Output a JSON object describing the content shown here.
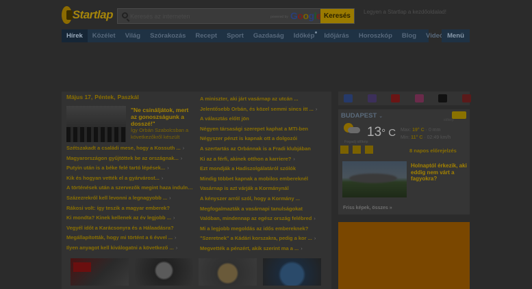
{
  "header": {
    "logo_text": "Startlap",
    "search_placeholder": "Keresés az interneten",
    "powered_by": "powered by",
    "google_letters": [
      {
        "ch": "G",
        "color": "#2a3f7a"
      },
      {
        "ch": "o",
        "color": "#7a1f1a"
      },
      {
        "ch": "o",
        "color": "#7a6200"
      },
      {
        "ch": "g",
        "color": "#2a3f7a"
      },
      {
        "ch": "l",
        "color": "#1f5a2a"
      },
      {
        "ch": "e",
        "color": "#7a1f1a"
      }
    ],
    "search_button": "Keresés",
    "top_links": [
      "Legyen a Startlap a kezdőoldalad!"
    ]
  },
  "nav": {
    "items": [
      {
        "label": "Hírek",
        "active": true
      },
      {
        "label": "Közélet"
      },
      {
        "label": "Világ"
      },
      {
        "label": "Szórakozás"
      },
      {
        "label": "Recept"
      },
      {
        "label": "Sport"
      },
      {
        "label": "Gazdaság"
      },
      {
        "label": "Időkép",
        "dot": true
      },
      {
        "label": "Időjárás"
      },
      {
        "label": "Horoszkóp"
      },
      {
        "label": "Blog"
      },
      {
        "label": "Videó"
      }
    ],
    "menu": "Menü"
  },
  "main": {
    "headline_bar": [
      "Május 17",
      "Péntek",
      "Paszkál"
    ],
    "featured": {
      "title": "\"Ne csináljátok, mert az gonoszságunk a dosszé!\"",
      "subtitle": "Így Orbán Szabolcsban a következőkről készült"
    },
    "left_list": [
      {
        "text": "Szétszakadt a családi mese, hogy a Kossuth ...",
        "more": true
      },
      {
        "text": "Magyarországon gyűjtöttek be az országnak...",
        "more": true
      },
      {
        "text": "Putyin után is a béke felé tartó lépések...",
        "more": true
      },
      {
        "text": "Kik és hogyan vették el a gyárvárost...",
        "more": true
      },
      {
        "text": "A történések után a szervezők megint haza indulnak...",
        "more": true
      },
      {
        "text": "Százezrekről kell levonni a legnagyobb ...",
        "more": true
      },
      {
        "text": "Rákosi volt: így teszik a magyar emberek?",
        "more": false
      },
      {
        "text": "Ki mondta? Kinek kellenek az év legjobb ...",
        "more": true
      },
      {
        "text": "Vegyél időt a Karácsonyra és a Hálaadásra?",
        "more": false
      },
      {
        "text": "Megállapították, hogy mi történt a 6 évvel ...",
        "more": true
      },
      {
        "text": "Ilyen anyagot kell kiválogatni a következő ...",
        "more": true
      }
    ],
    "right_list": [
      {
        "text": "A miniszter, aki járt vasárnap az utcán ...",
        "more": false
      },
      {
        "text": "Jelentősebb Orbán, és közel semmi sincs itt ...",
        "more": true
      },
      {
        "text": "A választás előtt jön",
        "more": false
      },
      {
        "text": "Négyen társasági szerepet kaphat a MTI-ben",
        "more": false
      },
      {
        "text": "Négyszer pénzt is kapnak ott a dolgozói",
        "more": false
      },
      {
        "text": "A szertartás az Orbánnak is a Fradi klubjában",
        "more": false
      },
      {
        "text": "Ki az a férfi, akinek otthon a karriere?",
        "more": true
      },
      {
        "text": "Ezt mondják a Hadiszolgálatáról szólók",
        "more": false
      },
      {
        "text": "Mindig többet kapnak a mobilos embereknél",
        "more": false
      },
      {
        "text": "Vasárnap is azt várják a Kormánynál",
        "more": false
      },
      {
        "text": "A kényszer arról szól, hogy a Kormány ...",
        "more": false
      },
      {
        "text": "Megfogalmazták a vasárnapi tanulságokat",
        "more": false
      },
      {
        "text": "Valóban, mindennap az egész ország felébred",
        "more": true
      },
      {
        "text": "Mi a legjobb megoldás az idős embereknek?",
        "more": false
      },
      {
        "text": "\"Szeretnek\" a Kádári korszakra, pedig a kor ...",
        "more": true
      },
      {
        "text": "Megvették a pénzért, akik szerint ma a ...",
        "more": true
      }
    ]
  },
  "sidebar": {
    "social_icons": [
      {
        "name": "facebook-icon",
        "color": "#263a6a"
      },
      {
        "name": "instagram-icon",
        "color": "#3c2f5a"
      },
      {
        "name": "youtube-icon",
        "color": "#6a1515"
      },
      {
        "name": "instagram-alt-icon",
        "color": "#6a2a4a"
      },
      {
        "name": "tiktok-icon",
        "color": "#111111"
      },
      {
        "name": "gmail-icon",
        "color": "#5a1a1a"
      }
    ],
    "weather": {
      "city": "BUDAPEST",
      "brand": "időkép",
      "temp": "13",
      "unit": "° C",
      "line1_label": "Max",
      "line1_val": "19° C",
      "line1_extra": "0 mm",
      "line2_label": "Min",
      "line2_val": "11° C",
      "line2_extra": "02:49 km/h",
      "tiny": "Fogadj időkép",
      "forecast_link": "8 napos előrejelzés",
      "news_title": "Holnaptól érkezik, aki eddig nem várt a fagyokra?",
      "more_link": "Friss képek, összes »"
    }
  }
}
